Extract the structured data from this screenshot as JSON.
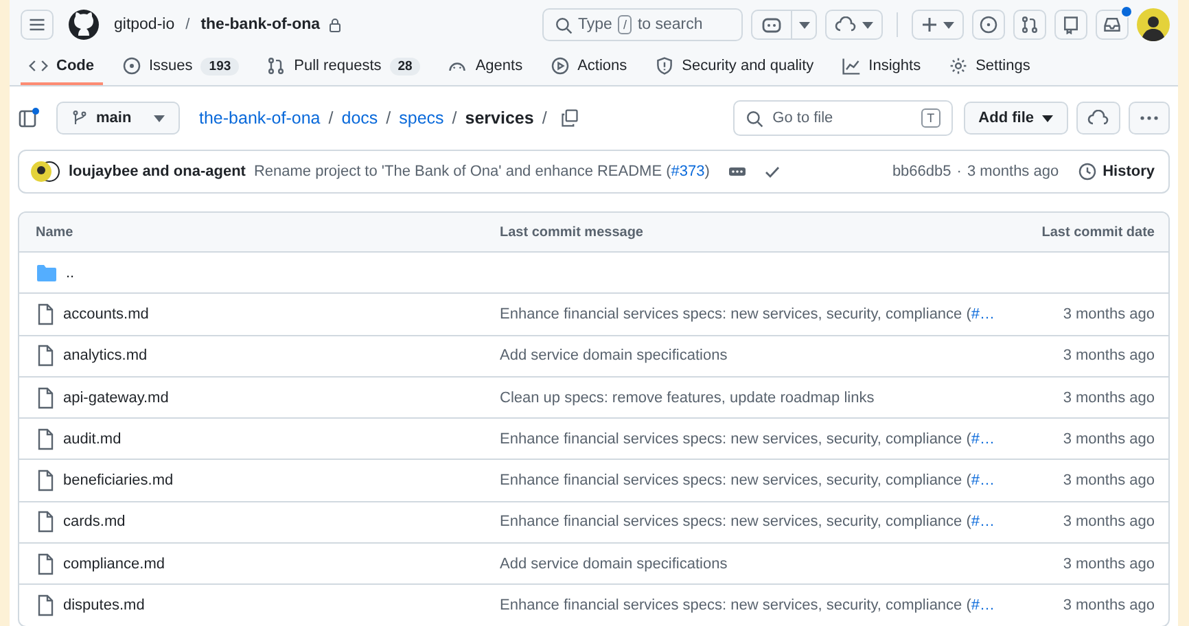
{
  "header": {
    "owner": "gitpod-io",
    "separator": "/",
    "repo": "the-bank-of-ona",
    "search_placeholder_before": "Type",
    "search_key": "/",
    "search_placeholder_after": "to search",
    "inbox_unread": true
  },
  "tabs": [
    {
      "label": "Code",
      "selected": true
    },
    {
      "label": "Issues",
      "count": "193",
      "selected": false
    },
    {
      "label": "Pull requests",
      "count": "28",
      "selected": false
    },
    {
      "label": "Agents",
      "selected": false
    },
    {
      "label": "Actions",
      "selected": false
    },
    {
      "label": "Security and quality",
      "selected": false
    },
    {
      "label": "Insights",
      "selected": false
    },
    {
      "label": "Settings",
      "selected": false
    }
  ],
  "branch": "main",
  "breadcrumb": [
    {
      "label": "the-bank-of-ona",
      "current": false,
      "separator": "/"
    },
    {
      "label": "docs",
      "current": false,
      "separator": "/"
    },
    {
      "label": "specs",
      "current": false,
      "separator": "/"
    },
    {
      "label": "services",
      "current": true,
      "separator": "/"
    }
  ],
  "go_to_file": {
    "placeholder": "Go to file",
    "key": "T"
  },
  "add_file": "Add file",
  "commit": {
    "authors": "loujaybee and ona-agent",
    "message": "Rename project to 'The Bank of Ona' and enhance README (",
    "link": "#373",
    "message_end": ")",
    "sha": "bb66db5",
    "dot": "·",
    "age": "3 months ago",
    "history": "History"
  },
  "table": {
    "columns": [
      "Name",
      "Last commit message",
      "Last commit date"
    ],
    "rows": [
      {
        "kind": "folder",
        "name": ".."
      },
      {
        "kind": "file",
        "name": "accounts.md",
        "message": "Enhance financial services specs: new services, security, compliance (",
        "link": "#…",
        "date": "3 months ago"
      },
      {
        "kind": "file",
        "name": "analytics.md",
        "message": "Add service domain specifications",
        "date": "3 months ago"
      },
      {
        "kind": "file",
        "name": "api-gateway.md",
        "message": "Clean up specs: remove features, update roadmap links",
        "date": "3 months ago"
      },
      {
        "kind": "file",
        "name": "audit.md",
        "message": "Enhance financial services specs: new services, security, compliance (",
        "link": "#…",
        "date": "3 months ago"
      },
      {
        "kind": "file",
        "name": "beneficiaries.md",
        "message": "Enhance financial services specs: new services, security, compliance (",
        "link": "#…",
        "date": "3 months ago"
      },
      {
        "kind": "file",
        "name": "cards.md",
        "message": "Enhance financial services specs: new services, security, compliance (",
        "link": "#…",
        "date": "3 months ago"
      },
      {
        "kind": "file",
        "name": "compliance.md",
        "message": "Add service domain specifications",
        "date": "3 months ago"
      },
      {
        "kind": "file",
        "name": "disputes.md",
        "message": "Enhance financial services specs: new services, security, compliance (",
        "link": "#…",
        "date": "3 months ago"
      }
    ]
  }
}
